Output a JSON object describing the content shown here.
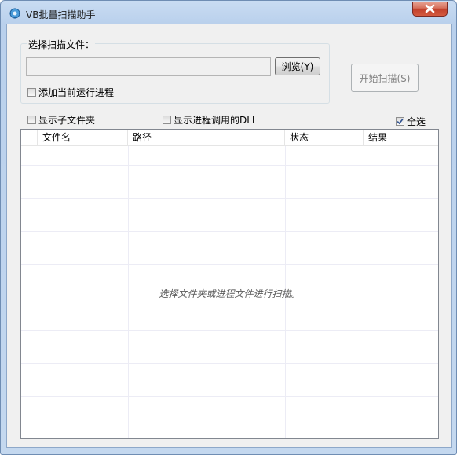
{
  "window": {
    "title": "VB批量扫描助手"
  },
  "scan_group": {
    "label": "选择扫描文件：",
    "path_value": "",
    "browse_label": "浏览(Y)",
    "add_running_label": "添加当前运行进程",
    "add_running_checked": false
  },
  "start_label": "开始扫描(S)",
  "options": {
    "show_subfolders_label": "显示子文件夹",
    "show_subfolders_checked": false,
    "show_dll_label": "显示进程调用的DLL",
    "show_dll_checked": false,
    "select_all_label": "全选",
    "select_all_checked": true
  },
  "list": {
    "columns": [
      "文件名",
      "路径",
      "状态",
      "结果"
    ],
    "empty_message": "选择文件夹或进程文件进行扫描。"
  }
}
